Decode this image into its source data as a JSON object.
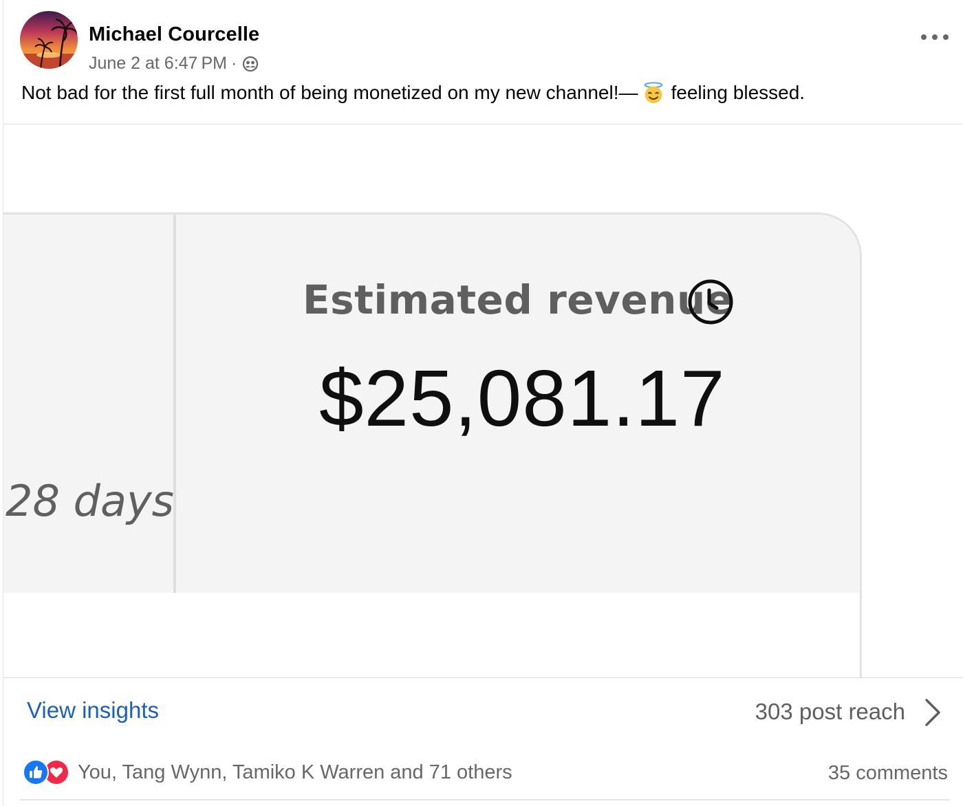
{
  "post": {
    "author": "Michael Courcelle",
    "timestamp": "June 2 at 6:47 PM",
    "separator": "·",
    "privacy_icon": "friends-icon",
    "more_icon": "more-options-icon",
    "caption_text": "Not bad for the first full month of being monetized on my new channel!—",
    "caption_emoji": "smiling-face-with-halo-emoji",
    "feeling_text": "feeling blessed."
  },
  "media": {
    "period_text": "28 days",
    "revenue_label": "Estimated revenue",
    "revenue_value": "$25,081.17",
    "clock_icon": "clock-icon"
  },
  "insights": {
    "link_label": "View insights",
    "reach_text": "303 post reach",
    "chevron_icon": "chevron-right-icon"
  },
  "engagement": {
    "reaction_icons": [
      "like-icon",
      "love-icon"
    ],
    "reactions_text": "You, Tang Wynn, Tamiko K Warren and 71 others",
    "comments_text": "35 comments"
  },
  "colors": {
    "link_blue": "#1b5fb8",
    "like_blue": "#1877f2",
    "love_red": "#f02849",
    "secondary_text": "#65676b"
  }
}
